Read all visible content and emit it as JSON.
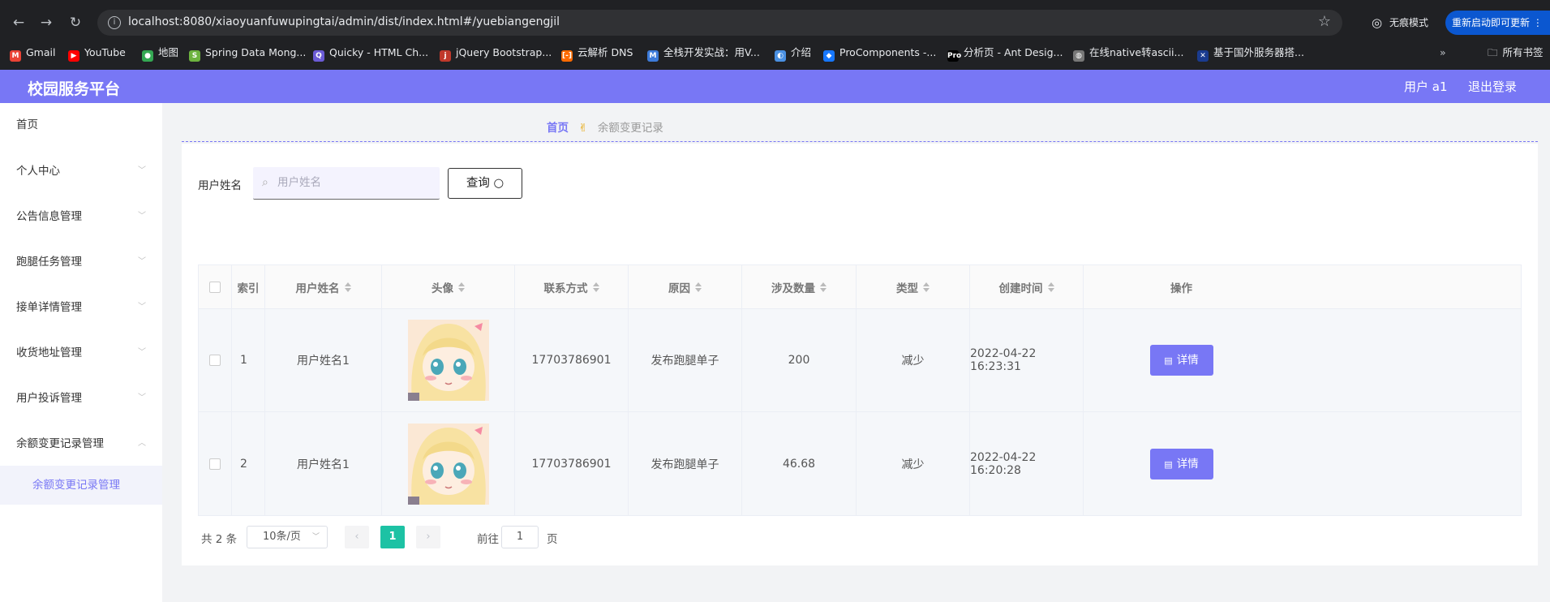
{
  "browser": {
    "url": "localhost:8080/xiaoyuanfuwupingtai/admin/dist/index.html#/yuebiangengjil",
    "incognito_label": "无痕模式",
    "restart_label": "重新启动即可更新",
    "all_bookmarks_label": "所有书签",
    "bookmarks": [
      {
        "label": "Gmail",
        "color": "#ea4335",
        "icon": "M"
      },
      {
        "label": "YouTube",
        "color": "#ff0000",
        "icon": "▶"
      },
      {
        "label": "地图",
        "color": "#34a853",
        "icon": "●"
      },
      {
        "label": "Spring Data Mong...",
        "color": "#6db33f",
        "icon": "S"
      },
      {
        "label": "Quicky - HTML Ch...",
        "color": "#6b5bd6",
        "icon": "Q"
      },
      {
        "label": "jQuery Bootstrap...",
        "color": "#c0392b",
        "icon": "j"
      },
      {
        "label": "云解析 DNS",
        "color": "#ff6a00",
        "icon": "[-]"
      },
      {
        "label": "全栈开发实战：用V...",
        "color": "#3d7bd9",
        "icon": "M"
      },
      {
        "label": "介绍",
        "color": "#4a90e2",
        "icon": "◐"
      },
      {
        "label": "ProComponents -...",
        "color": "#1677ff",
        "icon": "◆"
      },
      {
        "label": "分析页 - Ant Desig...",
        "color": "#000000",
        "icon": "Pro"
      },
      {
        "label": "在线native转ascii...",
        "color": "#777777",
        "icon": "◍"
      },
      {
        "label": "基于国外服务器搭...",
        "color": "#1a3b8f",
        "icon": "✕"
      }
    ]
  },
  "header": {
    "title": "校园服务平台",
    "user": "用户 a1",
    "logout": "退出登录"
  },
  "sidebar": {
    "items": [
      {
        "label": "首页"
      },
      {
        "label": "个人中心"
      },
      {
        "label": "公告信息管理"
      },
      {
        "label": "跑腿任务管理"
      },
      {
        "label": "接单详情管理"
      },
      {
        "label": "收货地址管理"
      },
      {
        "label": "用户投诉管理"
      },
      {
        "label": "余额变更记录管理"
      }
    ],
    "subitem": "余额变更记录管理"
  },
  "breadcrumb": {
    "home": "首页",
    "current": "余额变更记录"
  },
  "search": {
    "label": "用户姓名",
    "placeholder": "用户姓名",
    "button": "查询"
  },
  "table": {
    "columns": [
      "索引",
      "用户姓名",
      "头像",
      "联系方式",
      "原因",
      "涉及数量",
      "类型",
      "创建时间",
      "操作"
    ],
    "rows": [
      {
        "index": "1",
        "name": "用户姓名1",
        "phone": "17703786901",
        "reason": "发布跑腿单子",
        "amount": "200",
        "type": "减少",
        "time": "2022-04-22 16:23:31",
        "action": "详情"
      },
      {
        "index": "2",
        "name": "用户姓名1",
        "phone": "17703786901",
        "reason": "发布跑腿单子",
        "amount": "46.68",
        "type": "减少",
        "time": "2022-04-22 16:20:28",
        "action": "详情"
      }
    ]
  },
  "pagination": {
    "total": "共 2 条",
    "page_size": "10条/页",
    "current_page": "1",
    "goto_label": "前往",
    "goto_value": "1",
    "goto_suffix": "页"
  },
  "colors": {
    "accent": "#7877f5",
    "page_active": "#1dc2a4"
  }
}
